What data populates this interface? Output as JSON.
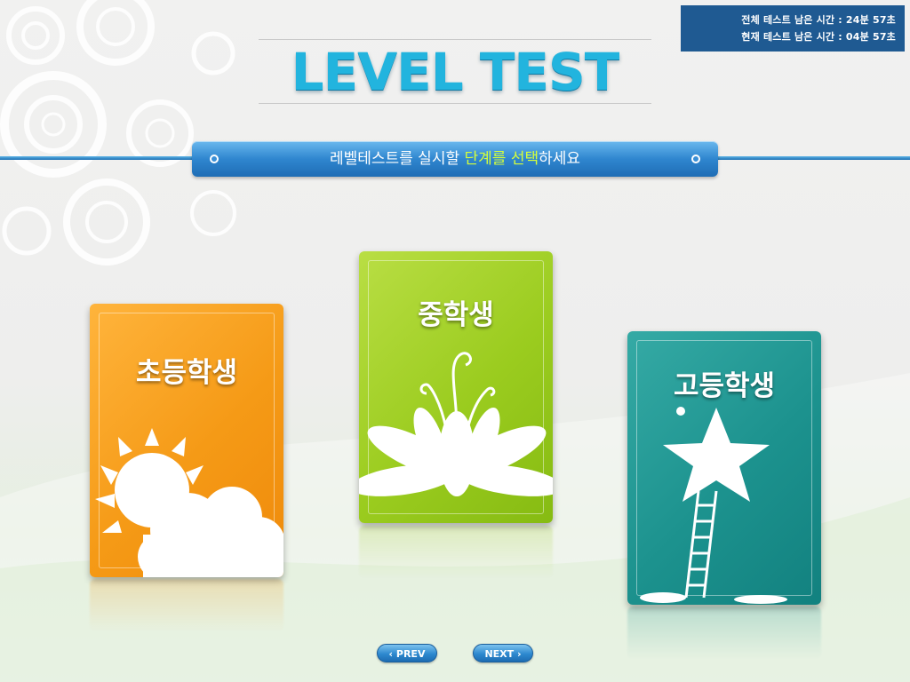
{
  "timer": {
    "total_label": "전체 테스트 남은 시간 : 24분 57초",
    "current_label": "현재 테스트 남은 시간 : 04분 57초"
  },
  "title": "LEVEL TEST",
  "instruction": {
    "part1": "레벨테스트를 실시할 ",
    "highlight1": "단계를",
    "part2": " ",
    "highlight2": "선택",
    "part3": "하세요"
  },
  "levels": [
    {
      "label": "초등학생",
      "color": "#f59a16",
      "icon": "sun-cloud-icon"
    },
    {
      "label": "중학생",
      "color": "#9bcc1f",
      "icon": "plant-icon"
    },
    {
      "label": "고등학생",
      "color": "#1c928e",
      "icon": "star-ladder-icon"
    }
  ],
  "nav": {
    "prev_label": "‹ PREV",
    "next_label": "NEXT ›"
  },
  "colors": {
    "title": "#22b4de",
    "bar": "#2f86cf",
    "highlight": "#d6ff3a",
    "timer_bg": "#1f5a92"
  }
}
